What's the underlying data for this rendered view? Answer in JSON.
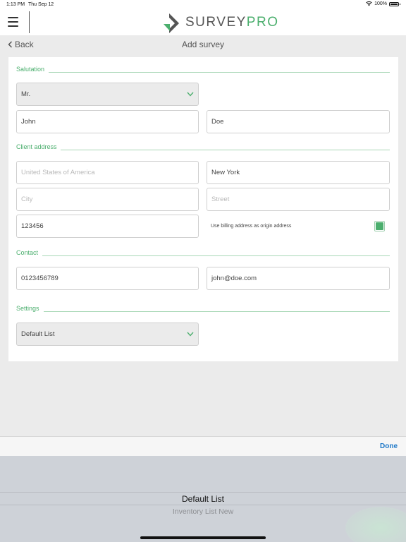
{
  "status_bar": {
    "time": "1:13 PM",
    "date": "Thu Sep 12",
    "battery": "100%"
  },
  "header": {
    "logo_part1": "SURVEY",
    "logo_part2": "PRO",
    "back_label": "Back",
    "title": "Add survey"
  },
  "sections": {
    "salutation": "Salutation",
    "client_address": "Client address",
    "contact": "Contact",
    "settings": "Settings"
  },
  "form": {
    "salutation_value": "Mr.",
    "first_name": "John",
    "last_name": "Doe",
    "country_placeholder": "United States of America",
    "state": "New York",
    "city_placeholder": "City",
    "street_placeholder": "Street",
    "zip": "123456",
    "billing_label": "Use billing address as origin address",
    "billing_checked": true,
    "phone": "0123456789",
    "email": "john@doe.com",
    "list_value": "Default List"
  },
  "toolbar": {
    "done_label": "Done"
  },
  "picker": {
    "options": [
      "Default List",
      "Inventory List New"
    ],
    "selected": "Default List"
  },
  "colors": {
    "accent": "#4caf6e",
    "link": "#1e78c8"
  }
}
